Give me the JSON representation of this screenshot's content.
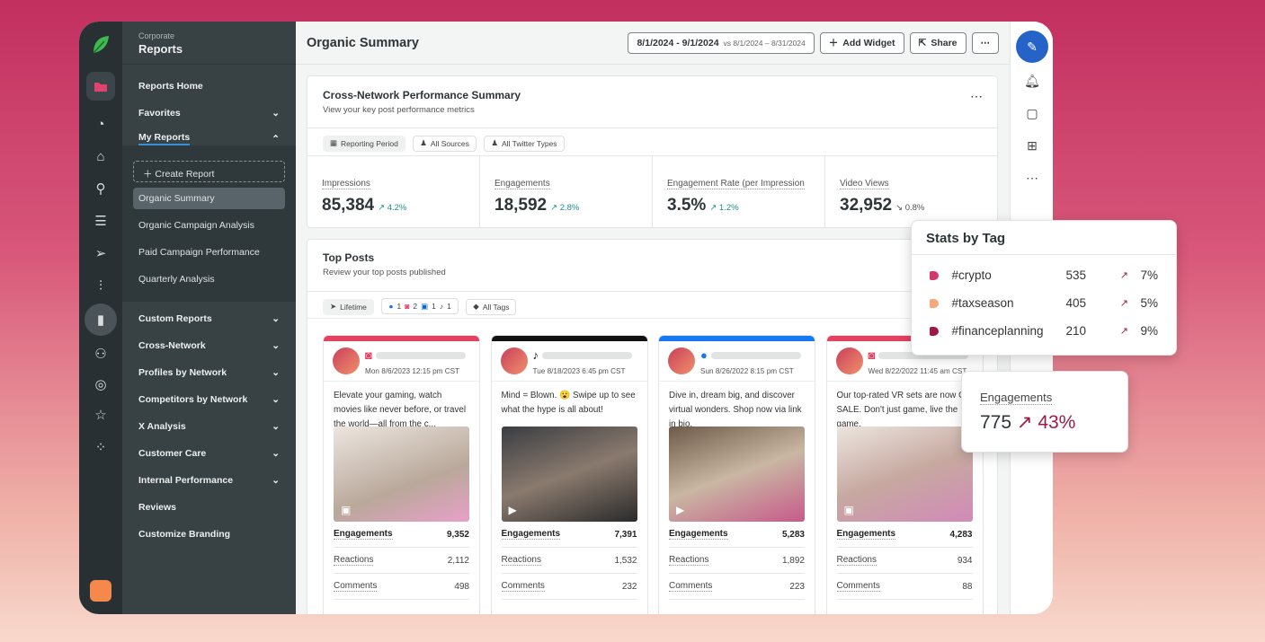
{
  "nav": {
    "org": "Corporate",
    "title": "Reports",
    "top_items": [
      {
        "label": "Reports Home"
      },
      {
        "label": "Favorites"
      },
      {
        "label": "My Reports"
      }
    ],
    "create_report": "Create Report",
    "my_reports": [
      "Organic Summary",
      "Organic Campaign Analysis",
      "Paid Campaign Performance",
      "Quarterly Analysis"
    ],
    "sections": [
      "Custom Reports",
      "Cross-Network",
      "Profiles by Network",
      "Competitors by Network",
      "X Analysis",
      "Customer Care",
      "Internal Performance",
      "Reviews",
      "Customize Branding"
    ]
  },
  "header": {
    "title": "Organic Summary",
    "date_range": "8/1/2024 - 9/1/2024",
    "compare_range": "vs 8/1/2024 – 8/31/2024",
    "add_widget": "Add Widget",
    "share": "Share"
  },
  "summary": {
    "title": "Cross-Network Performance Summary",
    "subtitle": "View your key post performance metrics",
    "filters": [
      "Reporting Period",
      "All Sources",
      "All Twitter Types"
    ],
    "metrics": [
      {
        "label": "Impressions",
        "value": "85,384",
        "delta": "↗ 4.2%"
      },
      {
        "label": "Engagements",
        "value": "18,592",
        "delta": "↗ 2.8%"
      },
      {
        "label": "Engagement Rate (per Impression",
        "value": "3.5%",
        "delta": "↗ 1.2%"
      },
      {
        "label": "Video Views",
        "value": "32,952",
        "delta": "↘ 0.8%"
      }
    ]
  },
  "top_posts": {
    "title": "Top Posts",
    "subtitle": "Review your top posts published",
    "filter_period": "Lifetime",
    "network_counts": {
      "facebook": "1",
      "instagram": "2",
      "linkedin": "1",
      "tiktok": "1"
    },
    "filter_tags": "All Tags",
    "posts": [
      {
        "network": "instagram",
        "date": "Mon 8/6/2023 12:15 pm CST",
        "text": "Elevate your gaming, watch movies like never before, or travel the world—all from the c...",
        "media": "image",
        "engagements": "9,352",
        "reactions": "2,112",
        "comments": "498"
      },
      {
        "network": "tiktok",
        "date": "Tue 8/18/2023 6:45 pm CST",
        "text": "Mind = Blown. 😮 Swipe up to see what the hype is all about!",
        "media": "video",
        "engagements": "7,391",
        "reactions": "1,532",
        "comments": "232"
      },
      {
        "network": "facebook",
        "date": "Sun 8/26/2022 8:15 pm CST",
        "text": "Dive in, dream big, and discover virtual wonders. Shop now via link in bio.",
        "media": "video",
        "engagements": "5,283",
        "reactions": "1,892",
        "comments": "223"
      },
      {
        "network": "instagram",
        "date": "Wed 8/22/2022 11:45 am CST",
        "text": "Our top-rated VR sets are now ON SALE. Don't just game, live the game.",
        "media": "image",
        "engagements": "4,283",
        "reactions": "934",
        "comments": "88"
      }
    ],
    "stat_labels": {
      "engagements": "Engagements",
      "reactions": "Reactions",
      "comments": "Comments"
    }
  },
  "stats_by_tag": {
    "title": "Stats by Tag",
    "rows": [
      {
        "tag": "#crypto",
        "count": "535",
        "change": "7%",
        "color": "#d2386a"
      },
      {
        "tag": "#taxseason",
        "count": "405",
        "change": "5%",
        "color": "#f5a97a"
      },
      {
        "tag": "#financeplanning",
        "count": "210",
        "change": "9%",
        "color": "#9b1b45"
      }
    ]
  },
  "engagement_popup": {
    "label": "Engagements",
    "value": "775",
    "change": "↗ 43%"
  },
  "colors": {
    "instagram": "#e4405f",
    "tiktok": "#111111",
    "facebook": "#1877f2",
    "accent": "#1c8f86",
    "brand": "#59c94a"
  }
}
